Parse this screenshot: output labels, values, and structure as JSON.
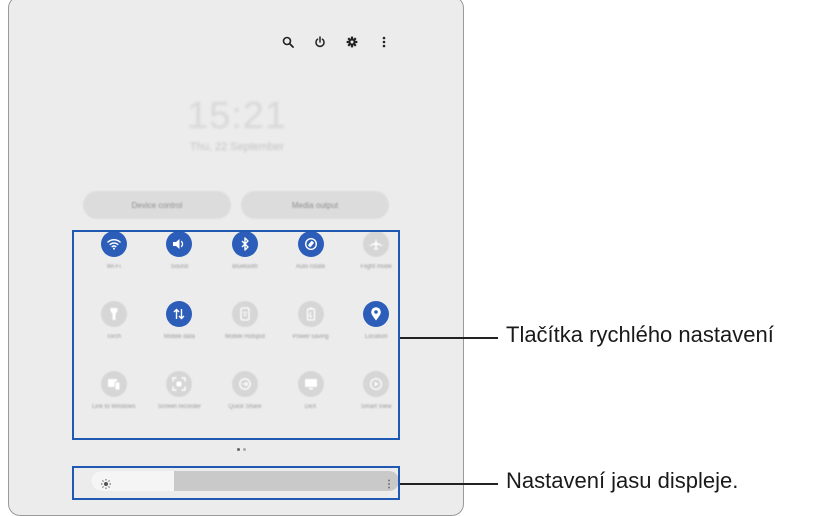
{
  "phone": {
    "clock": "15:21",
    "date": "Thu, 22 September",
    "top_icons": [
      "search-icon",
      "power-icon",
      "gear-icon",
      "more-vertical-icon"
    ],
    "device_control_label": "Device control",
    "media_output_label": "Media output"
  },
  "quick_settings": {
    "tiles": [
      {
        "label": "Wi-Fi",
        "icon": "wifi-icon",
        "active": true
      },
      {
        "label": "Sound",
        "icon": "sound-icon",
        "active": true
      },
      {
        "label": "Bluetooth",
        "icon": "bluetooth-icon",
        "active": true
      },
      {
        "label": "Auto rotate",
        "icon": "auto-rotate-icon",
        "active": true
      },
      {
        "label": "Flight mode",
        "icon": "airplane-icon",
        "active": false
      },
      {
        "label": "Torch",
        "icon": "torch-icon",
        "active": false
      },
      {
        "label": "Mobile data",
        "icon": "mobile-data-icon",
        "active": true
      },
      {
        "label": "Mobile Hotspot",
        "icon": "hotspot-icon",
        "active": false
      },
      {
        "label": "Power saving",
        "icon": "power-saving-icon",
        "active": false
      },
      {
        "label": "Location",
        "icon": "location-icon",
        "active": true
      },
      {
        "label": "Link to Windows",
        "icon": "link-to-windows-icon",
        "active": false
      },
      {
        "label": "Screen recorder",
        "icon": "screen-recorder-icon",
        "active": false
      },
      {
        "label": "Quick Share",
        "icon": "quick-share-icon",
        "active": false
      },
      {
        "label": "DeX",
        "icon": "dex-icon",
        "active": false
      },
      {
        "label": "Smart View",
        "icon": "smart-view-icon",
        "active": false
      }
    ]
  },
  "brightness": {
    "level": 0.27,
    "icon": "sun-icon"
  },
  "callouts": {
    "quick_settings": "Tlačítka rychlého nastavení",
    "brightness": "Nastavení jasu displeje."
  },
  "colors": {
    "accent": "#2b5db9",
    "highlight": "#1f59b3",
    "background": "#ececec"
  }
}
